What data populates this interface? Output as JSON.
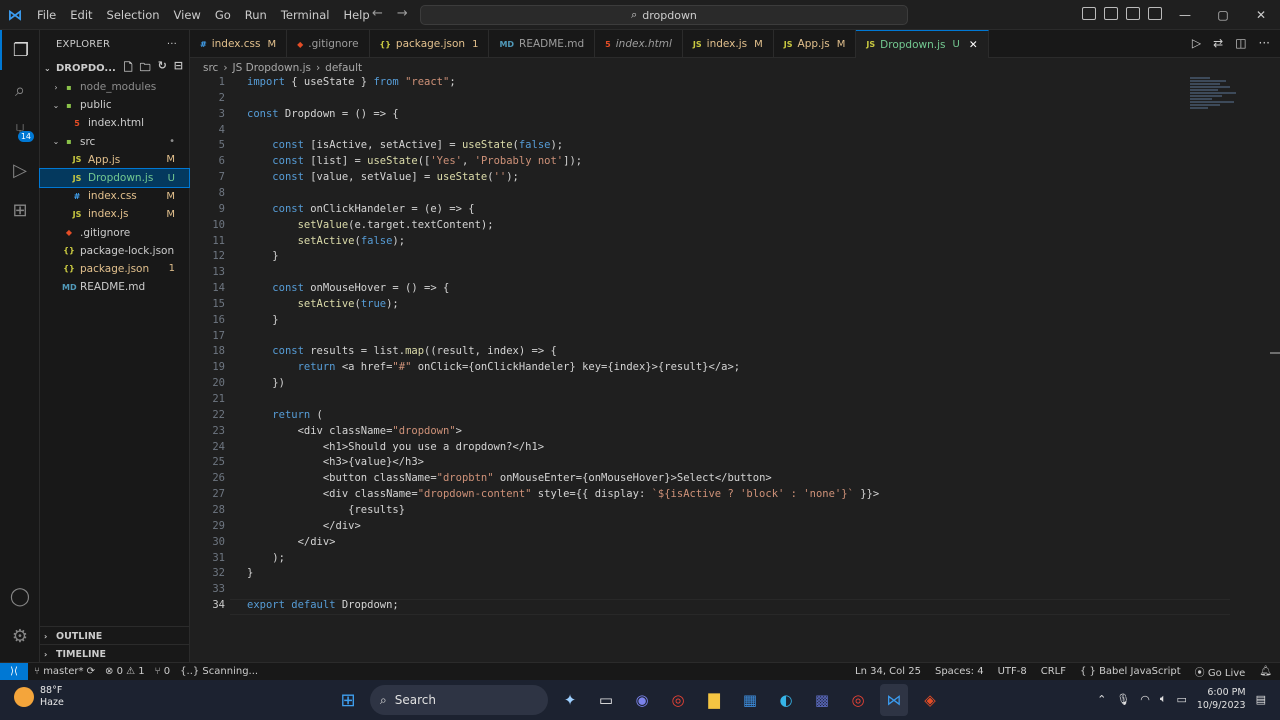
{
  "titlebar": {
    "menu": [
      "File",
      "Edit",
      "Selection",
      "View",
      "Go",
      "Run",
      "Terminal",
      "Help"
    ],
    "search": "dropdown"
  },
  "activity": {
    "scm_badge": "14"
  },
  "sidebar": {
    "title": "EXPLORER",
    "root": "DROPDO...",
    "tree": [
      {
        "label": "node_modules",
        "type": "folder",
        "indent": 1,
        "chev": "›",
        "status": ""
      },
      {
        "label": "public",
        "type": "folder",
        "indent": 1,
        "chev": "⌄",
        "status": ""
      },
      {
        "label": "index.html",
        "type": "html",
        "indent": 2,
        "chev": "",
        "status": ""
      },
      {
        "label": "src",
        "type": "folder",
        "indent": 1,
        "chev": "⌄",
        "status": "•"
      },
      {
        "label": "App.js",
        "type": "js",
        "indent": 2,
        "chev": "",
        "status": "M"
      },
      {
        "label": "Dropdown.js",
        "type": "js",
        "indent": 2,
        "chev": "",
        "status": "U"
      },
      {
        "label": "index.css",
        "type": "css",
        "indent": 2,
        "chev": "",
        "status": "M"
      },
      {
        "label": "index.js",
        "type": "js",
        "indent": 2,
        "chev": "",
        "status": "M"
      },
      {
        "label": ".gitignore",
        "type": "git",
        "indent": 1,
        "chev": "",
        "status": ""
      },
      {
        "label": "package-lock.json",
        "type": "json",
        "indent": 1,
        "chev": "",
        "status": ""
      },
      {
        "label": "package.json",
        "type": "json",
        "indent": 1,
        "chev": "",
        "status": "1"
      },
      {
        "label": "README.md",
        "type": "md",
        "indent": 1,
        "chev": "",
        "status": ""
      }
    ],
    "outline": "OUTLINE",
    "timeline": "TIMELINE"
  },
  "tabs": [
    {
      "label": "index.css",
      "type": "css",
      "mark": "M"
    },
    {
      "label": ".gitignore",
      "type": "git",
      "mark": ""
    },
    {
      "label": "package.json",
      "type": "json",
      "mark": "1"
    },
    {
      "label": "README.md",
      "type": "md",
      "mark": ""
    },
    {
      "label": "index.html",
      "type": "html",
      "mark": ""
    },
    {
      "label": "index.js",
      "type": "js",
      "mark": "M"
    },
    {
      "label": "App.js",
      "type": "js",
      "mark": "M"
    },
    {
      "label": "Dropdown.js",
      "type": "js",
      "mark": "U",
      "active": true
    }
  ],
  "breadcrumb": [
    "src",
    "JS Dropdown.js",
    "default"
  ],
  "code": [
    "import { useState } from \"react\";",
    "",
    "const Dropdown = () => {",
    "",
    "    const [isActive, setActive] = useState(false);",
    "    const [list] = useState(['Yes', 'Probably not']);",
    "    const [value, setValue] = useState('');",
    "",
    "    const onClickHandeler = (e) => {",
    "        setValue(e.target.textContent);",
    "        setActive(false);",
    "    }",
    "",
    "    const onMouseHover = () => {",
    "        setActive(true);",
    "    }",
    "",
    "    const results = list.map((result, index) => {",
    "        return <a href=\"#\" onClick={onClickHandeler} key={index}>{result}</a>;",
    "    })",
    "",
    "    return (",
    "        <div className=\"dropdown\">",
    "            <h1>Should you use a dropdown?</h1>",
    "            <h3>{value}</h3>",
    "            <button className=\"dropbtn\" onMouseEnter={onMouseHover}>Select</button>",
    "            <div className=\"dropdown-content\" style={{ display: `${isActive ? 'block' : 'none'}` }}>",
    "                {results}",
    "            </div>",
    "        </div>",
    "    );",
    "}",
    "",
    "export default Dropdown;"
  ],
  "current_line": 34,
  "statusbar": {
    "branch": "master*",
    "problems": "⊗ 0 ⚠ 1",
    "ports": "⑂ 0",
    "scanning": "{..} Scanning...",
    "position": "Ln 34, Col 25",
    "spaces": "Spaces: 4",
    "encoding": "UTF-8",
    "eol": "CRLF",
    "language": "{ } Babel JavaScript",
    "golive": "Go Live"
  },
  "taskbar": {
    "temp": "88°F",
    "weather": "Haze",
    "search": "Search",
    "time": "6:00 PM",
    "date": "10/9/2023"
  }
}
